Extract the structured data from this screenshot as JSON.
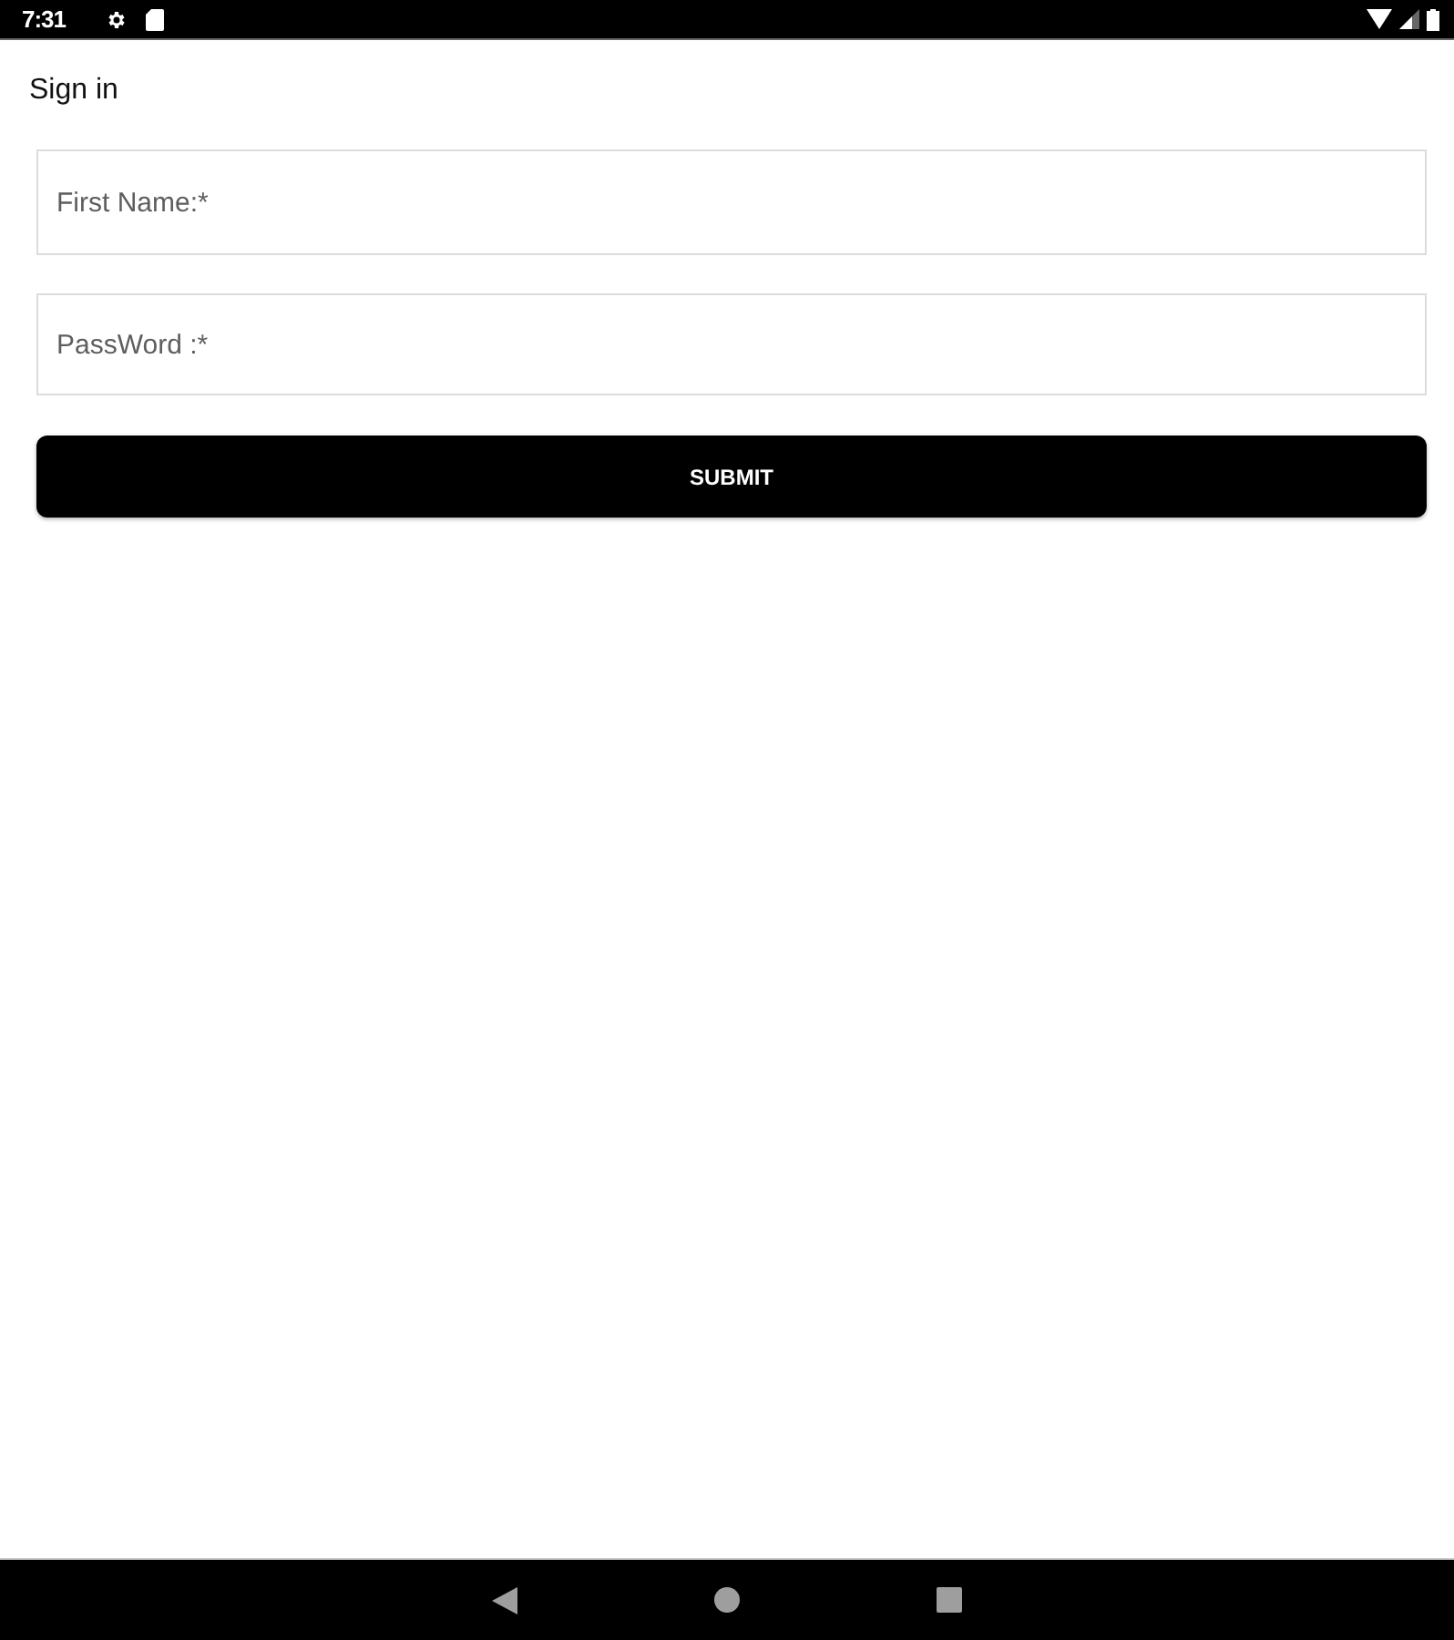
{
  "status_bar": {
    "time": "7:31"
  },
  "title": "Sign in",
  "fields": [
    {
      "placeholder": "First Name:*"
    },
    {
      "placeholder": "PassWord :*"
    }
  ],
  "submit_button": {
    "label": "SUBMIT"
  }
}
